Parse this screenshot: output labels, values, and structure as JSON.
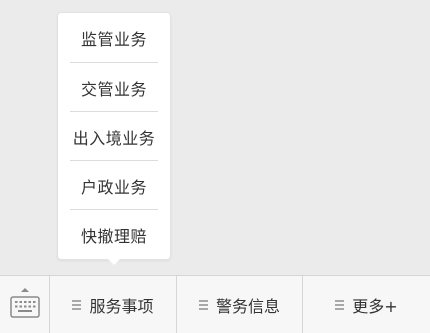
{
  "popup_menu": {
    "items": [
      {
        "label": "监管业务"
      },
      {
        "label": "交管业务"
      },
      {
        "label": "出入境业务"
      },
      {
        "label": "户政业务"
      },
      {
        "label": "快撤理赔"
      }
    ]
  },
  "menubar": {
    "keyboard_icon": "keyboard-icon",
    "tabs": [
      {
        "label": "服务事项",
        "icon": "hamburger-icon"
      },
      {
        "label": "警务信息",
        "icon": "hamburger-icon"
      },
      {
        "label": "更多+",
        "icon": "hamburger-icon"
      }
    ]
  }
}
